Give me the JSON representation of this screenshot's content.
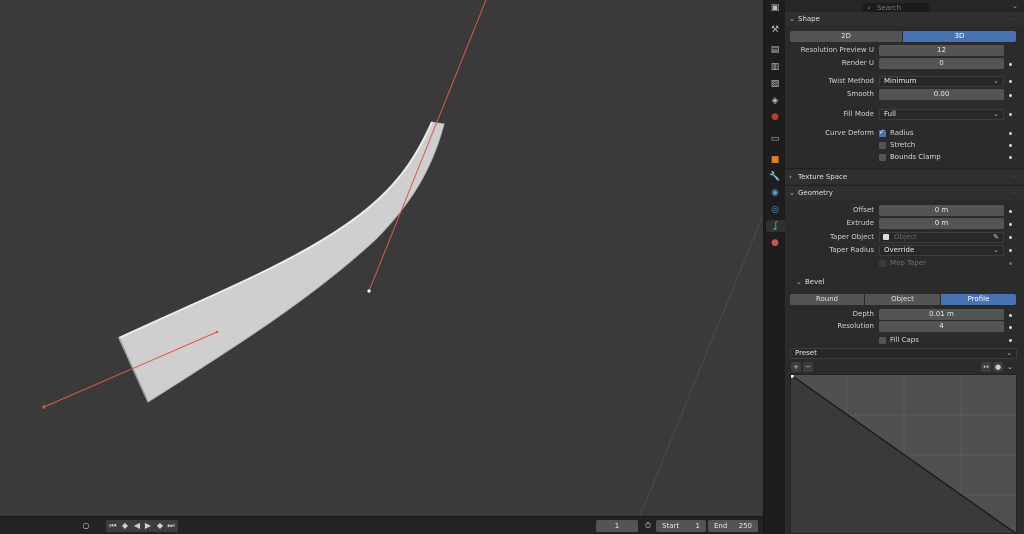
{
  "timeline": {
    "current_frame": "1",
    "start_label": "Start",
    "start_value": "1",
    "end_label": "End",
    "end_value": "250"
  },
  "properties": {
    "search_placeholder": "Search",
    "shape": {
      "header": "Shape",
      "mode_2d": "2D",
      "mode_3d": "3D",
      "resolution_preview_label": "Resolution Preview U",
      "resolution_preview_value": "12",
      "render_label": "Render U",
      "render_value": "0",
      "twist_method_label": "Twist Method",
      "twist_method_value": "Minimum",
      "smooth_label": "Smooth",
      "smooth_value": "0.00",
      "fill_mode_label": "Fill Mode",
      "fill_mode_value": "Full",
      "curve_deform_label": "Curve Deform",
      "radius_label": "Radius",
      "stretch_label": "Stretch",
      "bounds_clamp_label": "Bounds Clamp"
    },
    "texture_space": {
      "header": "Texture Space"
    },
    "geometry": {
      "header": "Geometry",
      "offset_label": "Offset",
      "offset_value": "0 m",
      "extrude_label": "Extrude",
      "extrude_value": "0 m",
      "taper_object_label": "Taper Object",
      "taper_object_placeholder": "Object",
      "taper_radius_label": "Taper Radius",
      "taper_radius_value": "Override",
      "map_taper_label": "Map Taper"
    },
    "bevel": {
      "header": "Bevel",
      "mode_round": "Round",
      "mode_object": "Object",
      "mode_profile": "Profile",
      "depth_label": "Depth",
      "depth_value": "0.01 m",
      "resolution_label": "Resolution",
      "resolution_value": "4",
      "fill_caps_label": "Fill Caps",
      "preset_label": "Preset"
    }
  },
  "colors": {
    "accent": "#4772b3",
    "viewport_bg": "#3a3a3a",
    "curve_handle": "#e8524a"
  }
}
